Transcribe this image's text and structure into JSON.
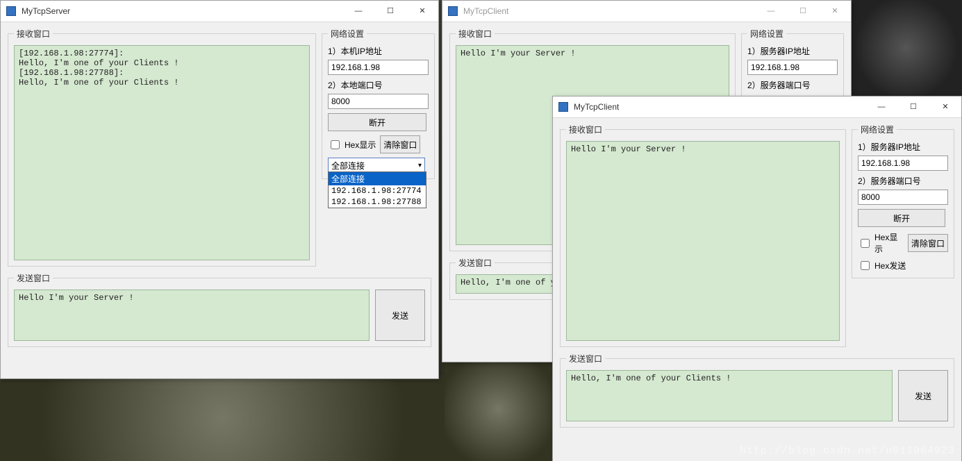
{
  "labels": {
    "recv_group": "接收窗口",
    "send_group": "发送窗口",
    "net_group": "网络设置",
    "local_ip": "1）本机IP地址",
    "local_port": "2）本地端口号",
    "server_ip": "1）服务器IP地址",
    "server_port": "2）服务器端口号",
    "disconnect": "断开",
    "hex_show": "Hex显示",
    "hex_send": "Hex发送",
    "clear": "清除窗口",
    "send": "发送"
  },
  "server": {
    "title": "MyTcpServer",
    "recv": "[192.168.1.98:27774]:\nHello, I'm one of your Clients !\n[192.168.1.98:27788]:\nHello, I'm one of your Clients !",
    "send": "Hello I'm your Server !",
    "ip": "192.168.1.98",
    "port": "8000",
    "combo_selected": "全部连接",
    "combo_items": [
      "全部连接",
      "192.168.1.98:27774",
      "192.168.1.98:27788"
    ]
  },
  "client1": {
    "title": "MyTcpClient",
    "recv": "Hello I'm your Server !",
    "send": "Hello, I'm one of your",
    "ip": "192.168.1.98"
  },
  "client2": {
    "title": "MyTcpClient",
    "recv": "Hello I'm your Server !",
    "send": "Hello, I'm one of your Clients !",
    "ip": "192.168.1.98",
    "port": "8000"
  },
  "watermark": "http://blog.csdn.net/u011964923"
}
